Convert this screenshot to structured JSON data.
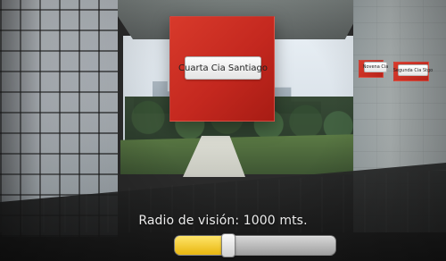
{
  "ar": {
    "markers": [
      {
        "label": "Cuarta Cia Santiago"
      },
      {
        "label": "Novena Cia"
      },
      {
        "label": "Segunda Cia Stgo"
      }
    ]
  },
  "radius": {
    "label": "Radio de visión: 1000 mts.",
    "slider_fraction": 0.33
  },
  "colors": {
    "marker_red": "#c4281f",
    "slider_fill": "#e8b60f"
  }
}
